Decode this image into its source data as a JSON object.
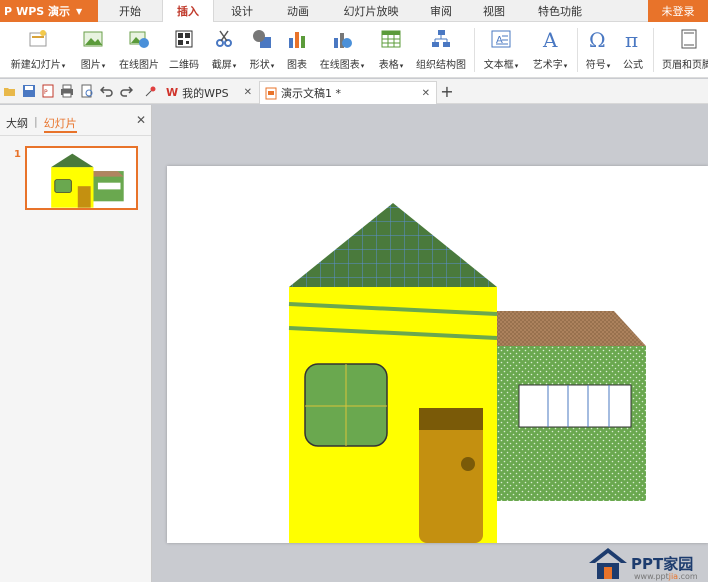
{
  "app": {
    "title": "WPS 演示"
  },
  "menu_tabs": [
    "开始",
    "插入",
    "设计",
    "动画",
    "幻灯片放映",
    "审阅",
    "视图",
    "特色功能"
  ],
  "active_menu_tab": "插入",
  "login_label": "未登录",
  "ribbon": {
    "new_slide": "新建幻灯片",
    "picture": "图片",
    "online_picture": "在线图片",
    "qrcode": "二维码",
    "screenshot": "截屏",
    "shapes": "形状",
    "chart": "图表",
    "online_chart": "在线图表",
    "table": "表格",
    "org_chart": "组织结构图",
    "textbox": "文本框",
    "wordart": "艺术字",
    "symbol": "符号",
    "formula": "公式",
    "header_footer": "页眉和页脚"
  },
  "doc_tabs": {
    "my_wps": "我的WPS",
    "current_doc": "演示文稿1 *"
  },
  "left_panel": {
    "outline_tab": "大纲",
    "separator": "|",
    "slides_tab": "幻灯片",
    "slide_number": "1"
  },
  "watermark": {
    "brand": "PPT家园",
    "site_pre": "www.ppt",
    "site_accent": "jia",
    "site_post": ".com"
  },
  "colors": {
    "accent": "#e8732a",
    "wall_yellow": "#ffff00",
    "roof_green": "#4a7a3c",
    "wall_green": "#6aa84f",
    "door": "#c49010",
    "roof_brown": "#b08560"
  }
}
